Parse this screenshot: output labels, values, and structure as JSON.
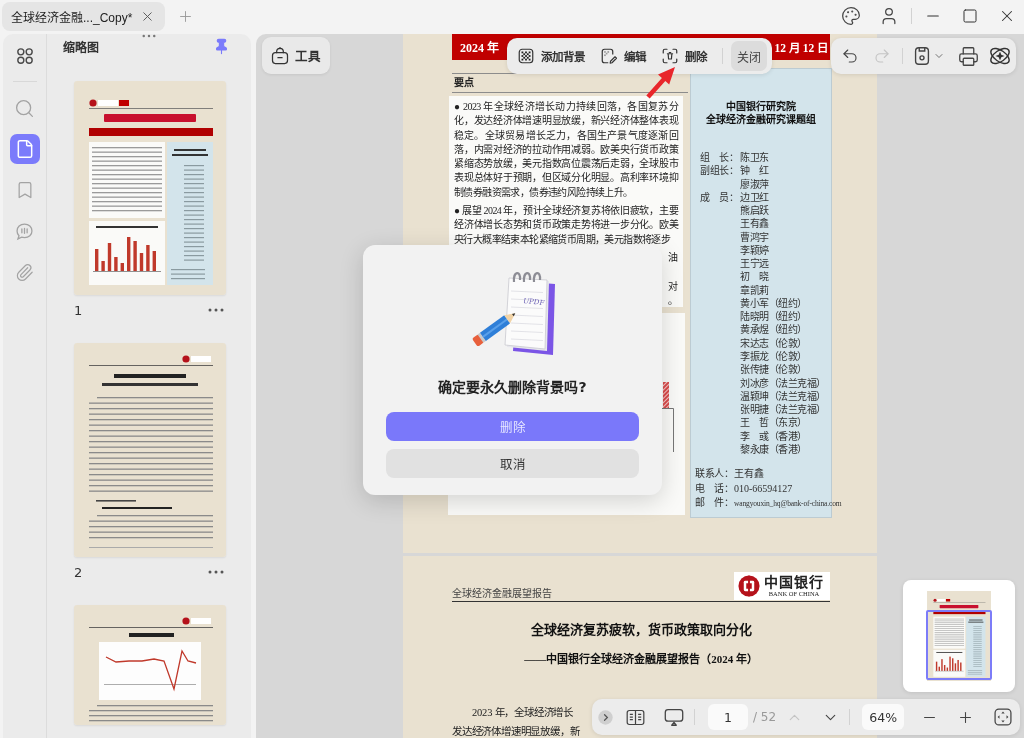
{
  "tabs": [
    {
      "title": "全球经济金融..._Copy*",
      "selected": true
    }
  ],
  "rail": [
    {
      "kind": "apps",
      "selected": false
    },
    {
      "kind": "search",
      "selected": false
    },
    {
      "kind": "pages",
      "selected": true
    },
    {
      "kind": "bookmarks",
      "selected": false
    },
    {
      "kind": "comments",
      "selected": false
    },
    {
      "kind": "attachments",
      "selected": false
    }
  ],
  "sidebar": {
    "title": "缩略图",
    "pinned": true,
    "thumbnails": [
      {
        "kind": "cover",
        "label": "1"
      },
      {
        "kind": "text",
        "label": "2"
      },
      {
        "kind": "chart"
      }
    ]
  },
  "tools_button": {
    "label": "工具"
  },
  "background_toolbar": {
    "actions": [
      {
        "kind": "add",
        "label": "添加背景"
      },
      {
        "kind": "edit",
        "label": "编辑"
      },
      {
        "kind": "delete",
        "label": "删除"
      }
    ],
    "close": "关闭"
  },
  "edit_toolbar": {
    "history": [
      {
        "kind": "undo",
        "disabled": false
      },
      {
        "kind": "redo",
        "disabled": true
      }
    ],
    "actions": [
      {
        "kind": "save",
        "menu": true
      },
      {
        "kind": "print"
      },
      {
        "kind": "ai"
      }
    ]
  },
  "page_1": {
    "banner_left": "2024 年",
    "banner_right": "12 月 12 日",
    "section_title": "要点",
    "bullets": [
      "● 2023 年全球经济增长动力持续回落，各国复苏分化，发达经济体增速明显放缓，新兴经济体整体表现稳定。全球贸易增长乏力，各国生产景气度逐渐回落，内需对经济的拉动作用减弱。欧美央行货币政策紧缩态势放缓，美元指数高位震荡后走弱，全球股市表现总体好于预期，但区域分化明显。高利率环境抑制债券融资需求，债券违约风险持续上升。",
      "● 展望 2024 年，预计全球经济复苏将依旧疲软，主要经济体增长态势和货币政策走势将进一步分化。欧美央行大概率结束本轮紧缩货币周期，美元指数将逐步"
    ],
    "covered_line_ends": [
      "油",
      "对",
      "。"
    ],
    "team_panel": {
      "title_lines": [
        "中国银行研究院",
        "全球经济金融研究课题组"
      ],
      "groups": [
        {
          "role": "组　长：",
          "names": [
            "陈卫东"
          ]
        },
        {
          "role": "副组长：",
          "names": [
            "钟　红",
            "廖淑萍"
          ]
        },
        {
          "role": "成　员：",
          "names": [
            "边卫红",
            "熊启跃",
            "王有鑫",
            "曹鸿宇",
            "李颖婷",
            "王宁远",
            "初　晓",
            "章凯莉",
            "黄小军（纽约）",
            "陆晓明（纽约）",
            "黄承煜（纽约）",
            "宋达志（伦敦）",
            "李振龙（伦敦）",
            "张传捷（伦敦）",
            "刘冰彦（法兰克福）",
            "温颖坤（法兰克福）",
            "张明捷（法兰克福）",
            "王　哲（东京）",
            "李　彧（香港）",
            "黎永康（香港）"
          ]
        }
      ],
      "contacts": [
        {
          "kind": "person",
          "label": "联系人：",
          "value": "王有鑫"
        },
        {
          "kind": "phone",
          "label": "电　话：",
          "value": "010-66594127"
        },
        {
          "kind": "email",
          "label": "邮　件：",
          "value": "wangyouxin_hq@bank-of-china.com"
        }
      ]
    }
  },
  "page_2": {
    "running_head": "全球经济金融展望报告",
    "logo": {
      "name": "中国银行",
      "english": "BANK OF CHINA"
    },
    "title": "全球经济复苏疲软，货币政策取向分化",
    "subtitle": "——中国银行全球经济金融展望报告（2024 年）",
    "body_lines": [
      "2023 年，全球经济增长",
      "发达经济体增速明显放缓，新"
    ]
  },
  "dialog": {
    "illustration_text": "UPDF",
    "title": "确定要永久删除背景吗?",
    "confirm": "删除",
    "cancel": "取消"
  },
  "page_bar": {
    "page": "1",
    "total": "/ 52",
    "previous": {
      "disabled": true
    },
    "next": {
      "disabled": false
    },
    "zoom": "64%"
  }
}
